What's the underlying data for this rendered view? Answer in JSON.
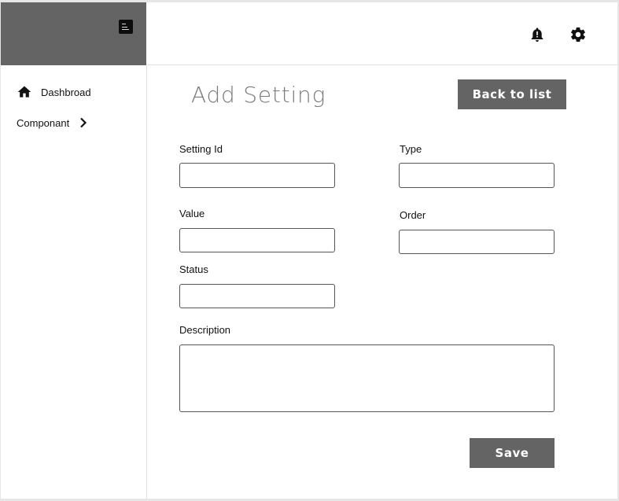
{
  "sidebar": {
    "items": [
      {
        "label": "Dashbroad",
        "icon": "home-icon"
      },
      {
        "label": "Componant",
        "icon": "chevron-right-icon"
      }
    ]
  },
  "header": {
    "icons": [
      "bell-alert-icon",
      "gear-icon"
    ]
  },
  "page": {
    "title": "Add Setting",
    "back_label": "Back to list",
    "save_label": "Save"
  },
  "form": {
    "setting_id": {
      "label": "Setting Id",
      "value": ""
    },
    "type": {
      "label": "Type",
      "value": ""
    },
    "value": {
      "label": "Value",
      "value": ""
    },
    "order": {
      "label": "Order",
      "value": ""
    },
    "status": {
      "label": "Status",
      "value": ""
    },
    "description": {
      "label": "Description",
      "value": ""
    }
  },
  "colors": {
    "brand_bar": "#646464",
    "button": "#646464",
    "title": "#7b7b7b"
  }
}
